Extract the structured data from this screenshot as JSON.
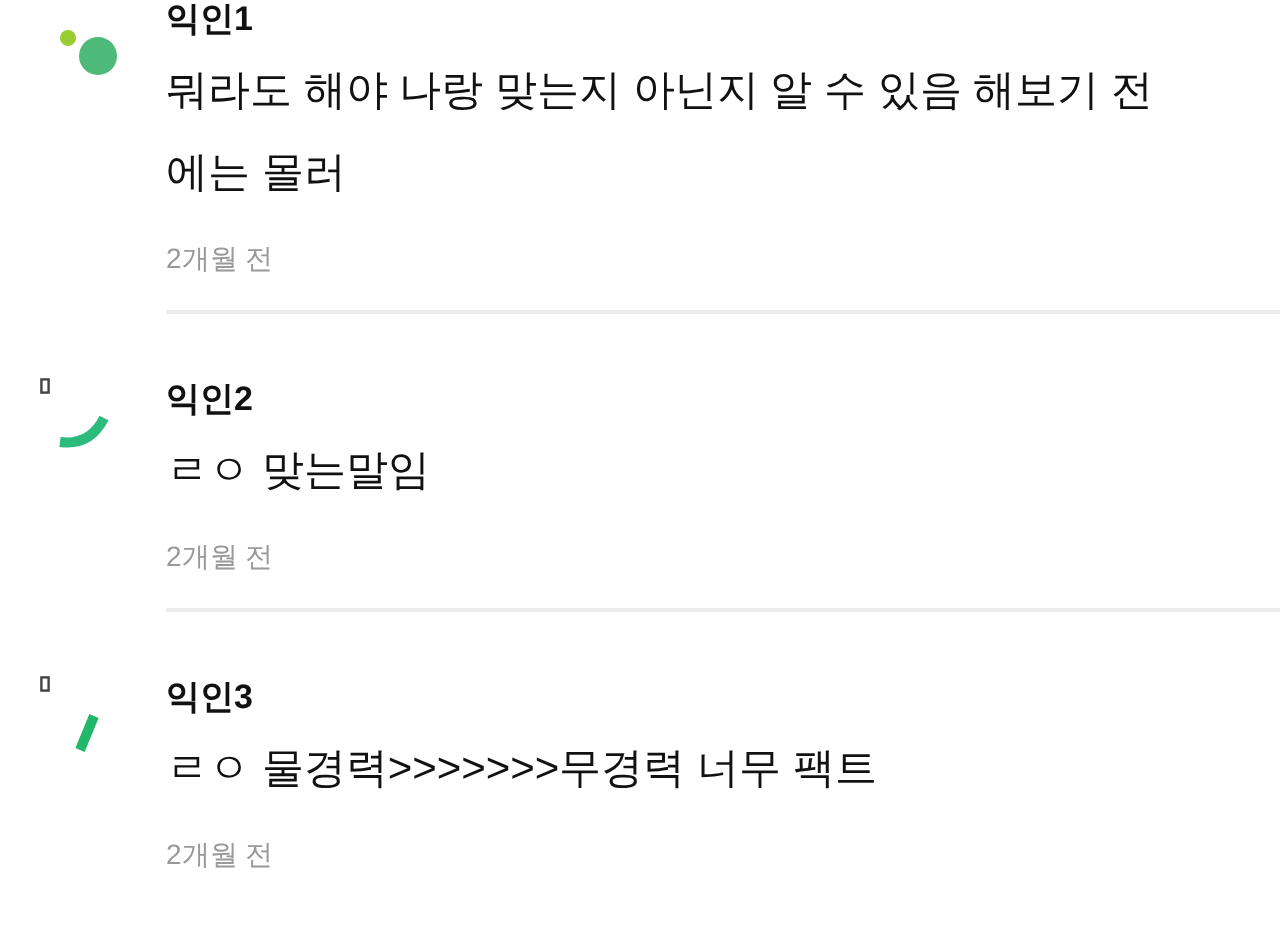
{
  "comments": [
    {
      "author": "익인1",
      "body": "뭐라도 해야 나랑 맞는지 아닌지 알 수 있음 해보기 전에는 몰러",
      "time": "2개월 전"
    },
    {
      "author": "익인2",
      "body": "ㄹㅇ 맞는말임",
      "time": "2개월 전"
    },
    {
      "author": "익인3",
      "body": "ㄹㅇ 물경력>>>>>>>무경력 너무 팩트",
      "time": "2개월 전"
    }
  ]
}
